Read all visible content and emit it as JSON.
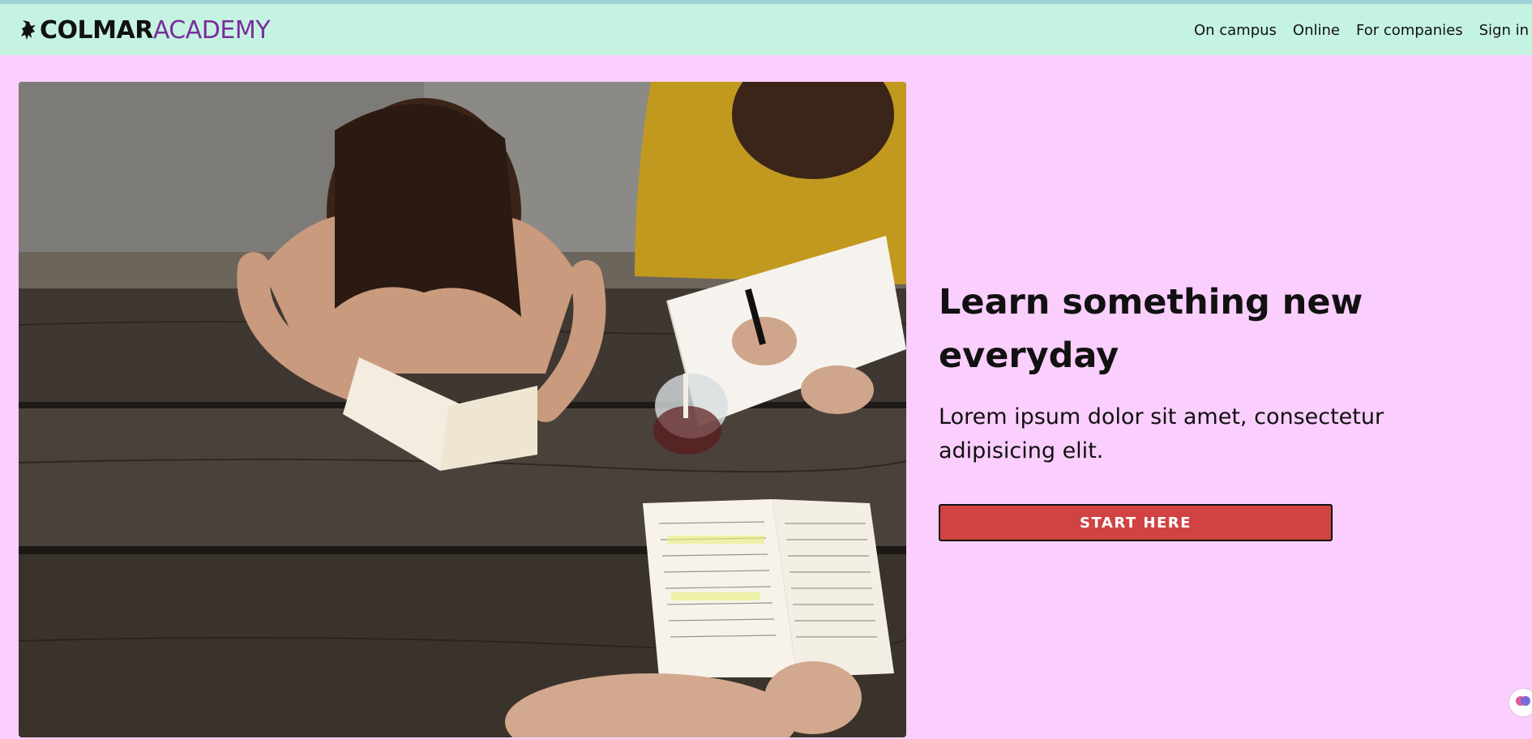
{
  "brand": {
    "name_part1": "COLMAR",
    "name_part2": "ACADEMY",
    "logo_icon": "griffin-icon",
    "color_part2": "#7a2c9e"
  },
  "nav": {
    "items": [
      {
        "label": "On campus"
      },
      {
        "label": "Online"
      },
      {
        "label": "For companies"
      },
      {
        "label": "Sign in"
      }
    ]
  },
  "hero": {
    "image_alt_icon": "students-studying-photo",
    "headline": "Learn something new everyday",
    "subtext": "Lorem ipsum dolor sit amet, consectetur adipisicing elit.",
    "cta_label": "START HERE"
  },
  "colors": {
    "header_bg": "#c5f3e1",
    "page_bg": "#facefd",
    "cta_bg": "#d14242"
  },
  "floating_widget": {
    "icon": "brain-icon"
  }
}
